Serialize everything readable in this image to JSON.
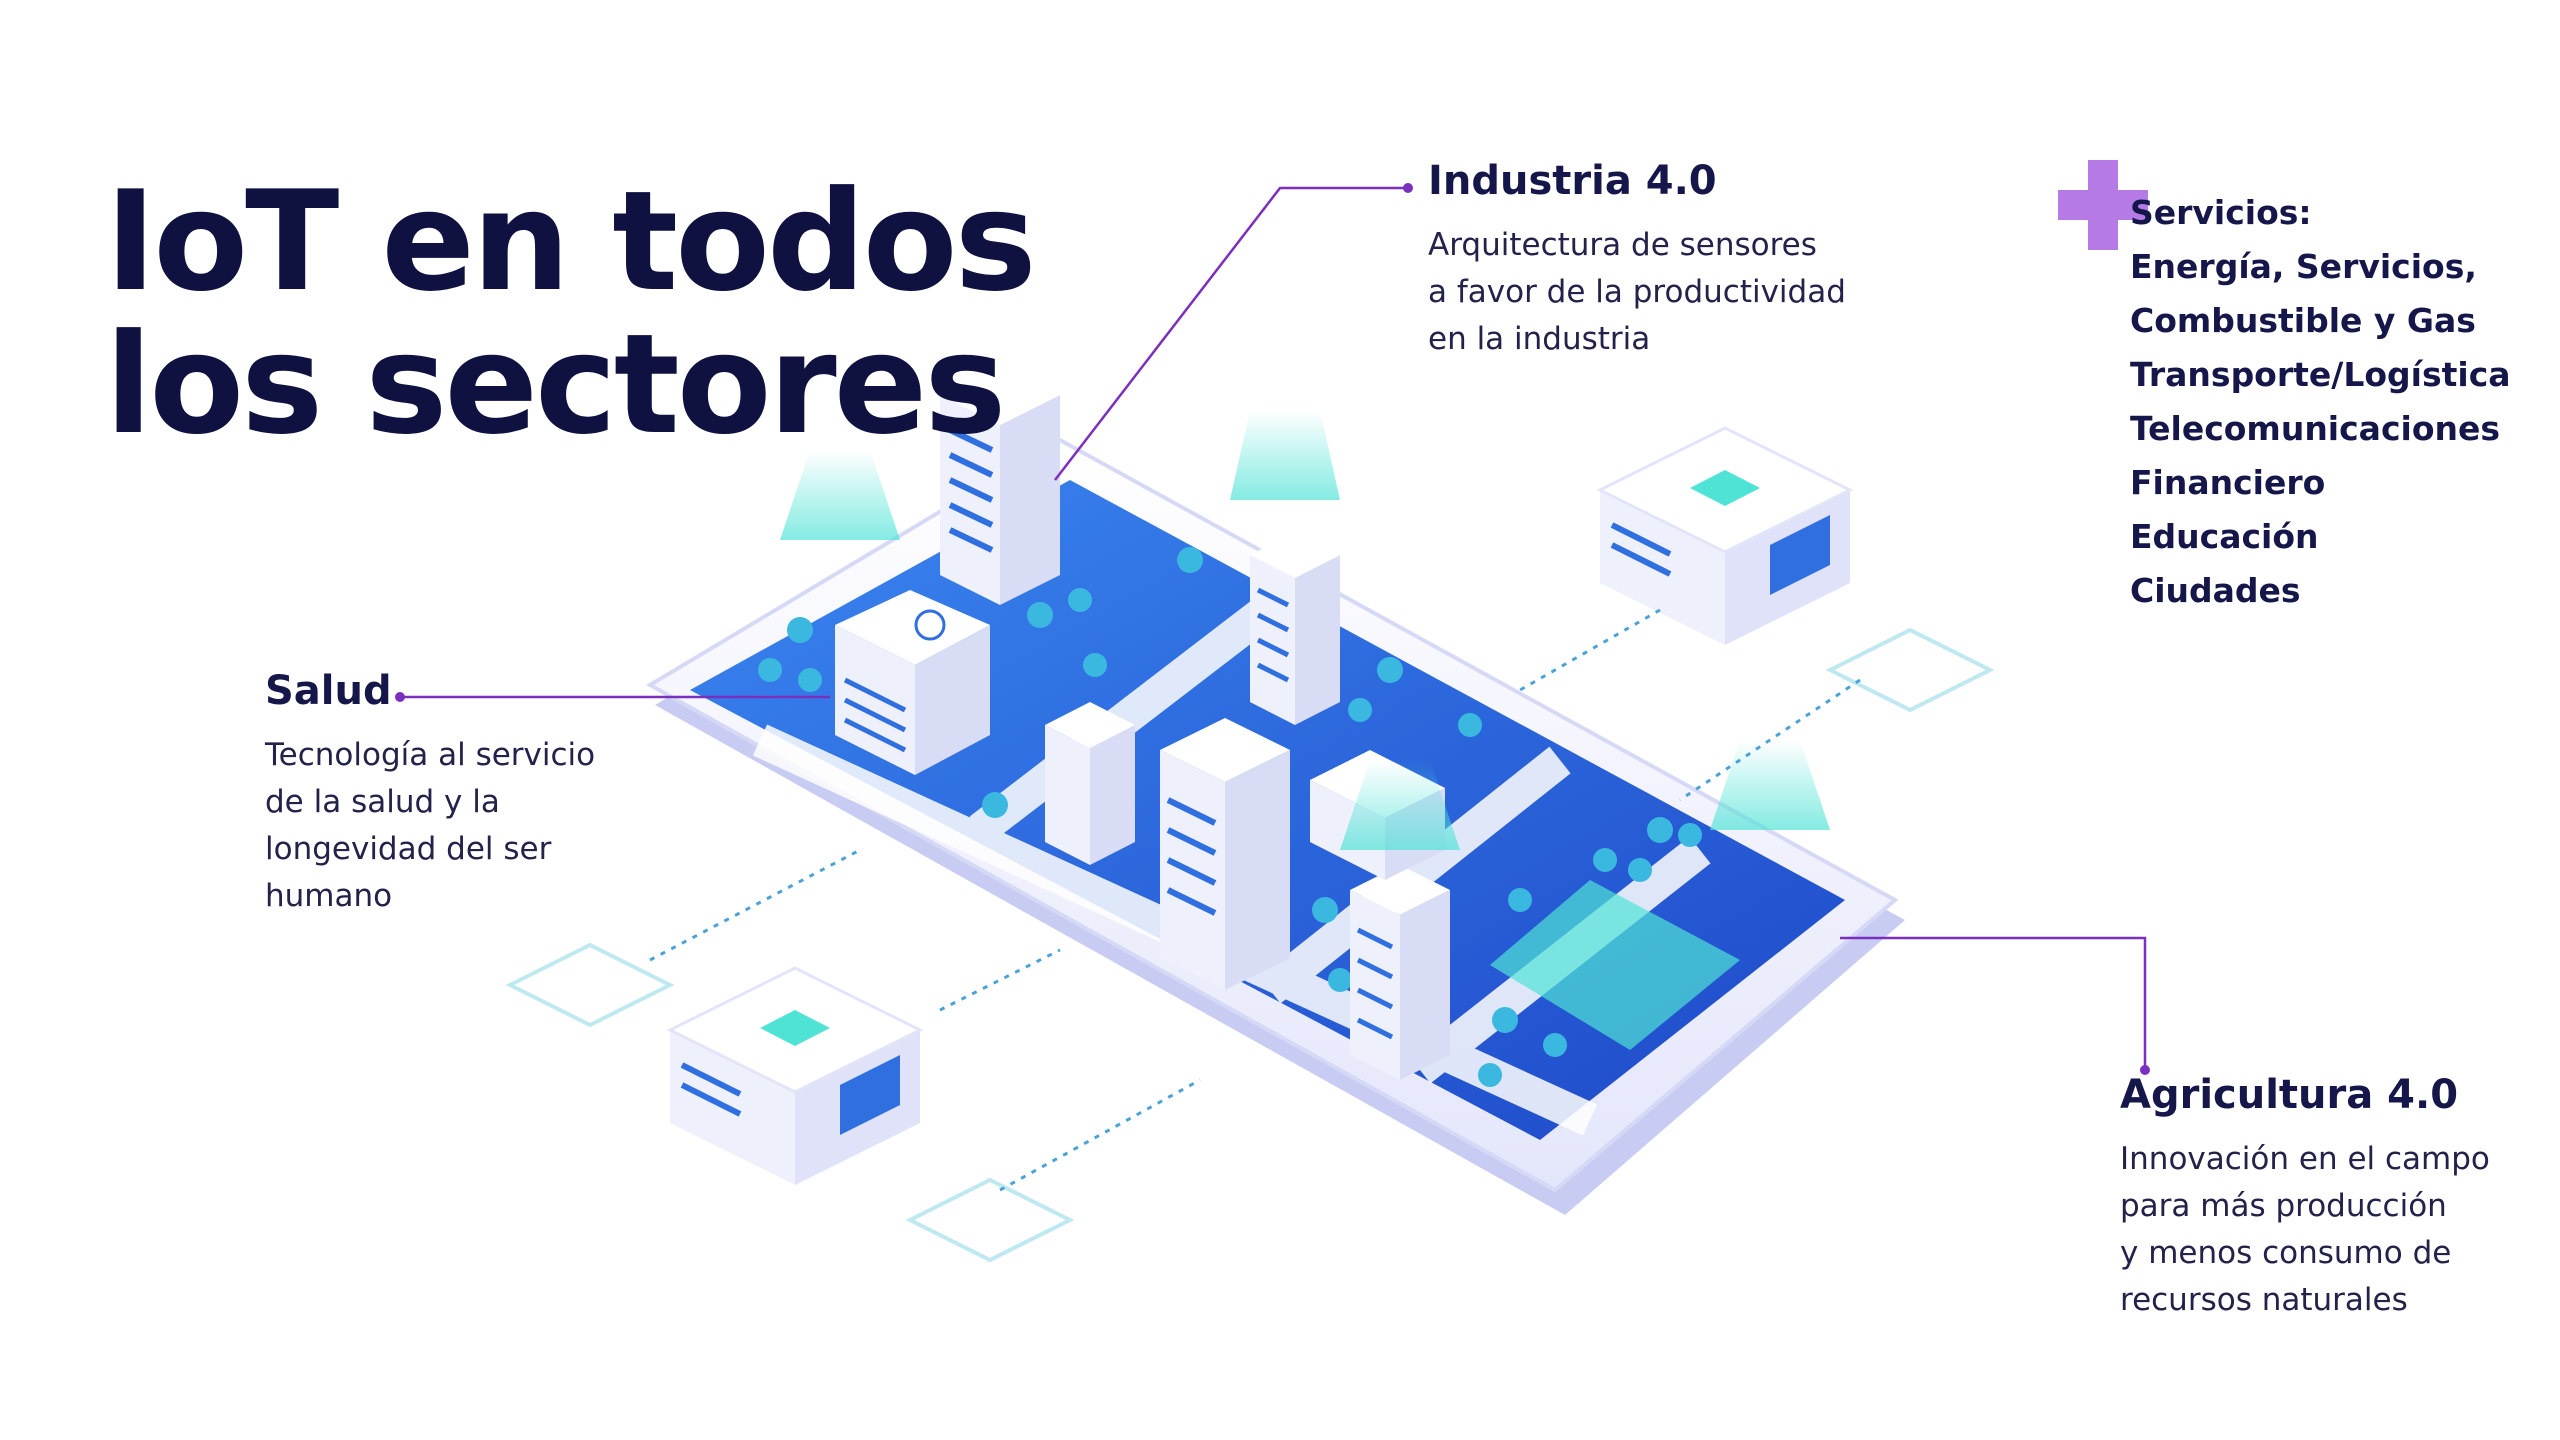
{
  "title": {
    "line1": "IoT en todos",
    "line2": "los sectores"
  },
  "industria": {
    "title": "Industria 4.0",
    "desc": [
      "Arquitectura de sensores",
      "a favor de la productividad",
      "en la industria"
    ]
  },
  "salud": {
    "title": "Salud",
    "desc": [
      "Tecnología al servicio",
      "de la salud y la",
      "longevidad del ser",
      "humano"
    ]
  },
  "agricultura": {
    "title": "Agricultura 4.0",
    "desc": [
      "Innovación en el campo",
      "para más producción",
      "y menos consumo de",
      "recursos naturales"
    ]
  },
  "servicios": {
    "items": [
      "Servicios:",
      "Energía, Servicios,",
      "Combustible y Gas",
      "Transporte/Logística",
      "Telecomunicaciones",
      "Financiero",
      "Educación",
      "Ciudades"
    ]
  },
  "colors": {
    "accent": "#7b2fbf",
    "plus": "#b57ae6",
    "navy": "#0f1140",
    "blue": "#2f6fe0",
    "cyan": "#4fe3d6"
  }
}
